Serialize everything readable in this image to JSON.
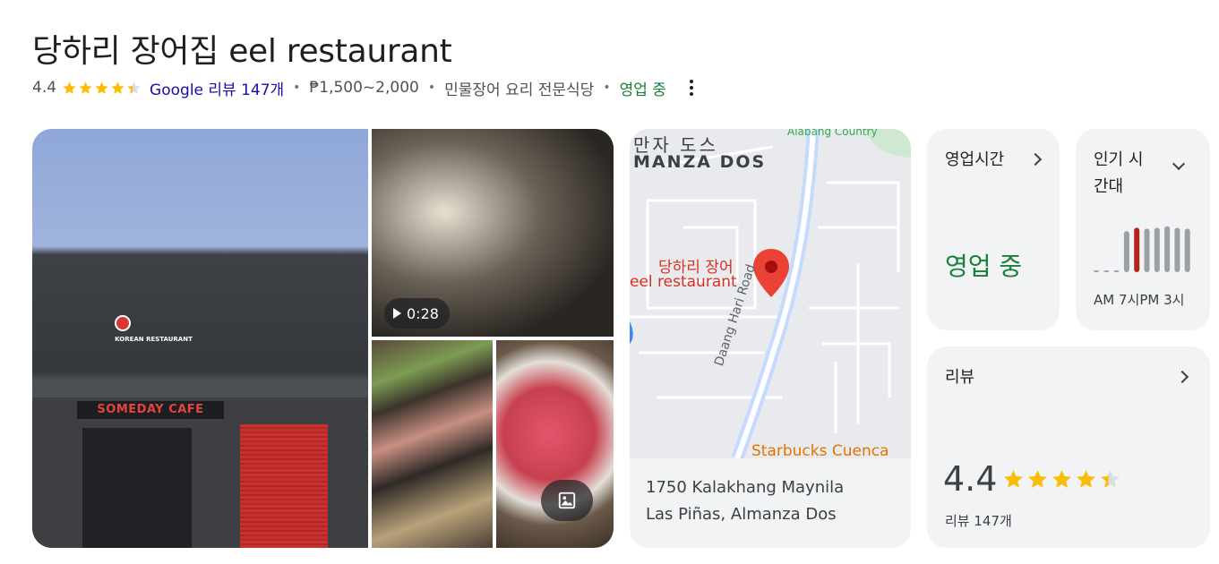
{
  "title": "당하리 장어집 eel restaurant",
  "meta": {
    "rating": "4.4",
    "reviews_link": "Google 리뷰 147개",
    "separator": "•",
    "price": "₱1,500~2,000",
    "category": "민물장어 요리 전문식당",
    "status": "영업 중"
  },
  "photos": {
    "video_duration": "0:28",
    "storefront_sign": "SOMEDAY CAFE",
    "restaurant_sign": "KOREAN RESTAURANT"
  },
  "map": {
    "area_label_kr": "만자 도스",
    "area_label": "MANZA DOS",
    "top_right_label": "Alabang Country",
    "pin_label_line1": "당하리 장어",
    "pin_label_line2": "eel restaurant",
    "road_label": "Daang Hari Road",
    "poi_label": "Starbucks Cuenca",
    "address_line1": "1750 Kalakhang Maynila",
    "address_line2": "Las Piñas, Almanza Dos"
  },
  "hours_card": {
    "title": "영업시간",
    "status": "영업 중"
  },
  "popular_card": {
    "title_line1": "인기 시",
    "title_line2": "간대",
    "axis_left": "AM 7시",
    "axis_right": "PM 3시",
    "bar_levels": [
      0.02,
      0.02,
      0.02,
      0.85,
      0.92,
      0.9,
      0.92,
      0.95,
      0.92,
      0.9
    ],
    "highlight_index": 4,
    "bar_color": "#9aa0a6",
    "highlight_color": "#b3261e"
  },
  "reviews_card": {
    "title": "리뷰",
    "rating": "4.4",
    "rating_value": 4.4,
    "count": "리뷰 147개"
  },
  "colors": {
    "star": "#fbbc04",
    "star_empty": "#dadce0",
    "open_green": "#188038",
    "link_blue": "#1a0dab",
    "map_pin": "#ea4335"
  }
}
